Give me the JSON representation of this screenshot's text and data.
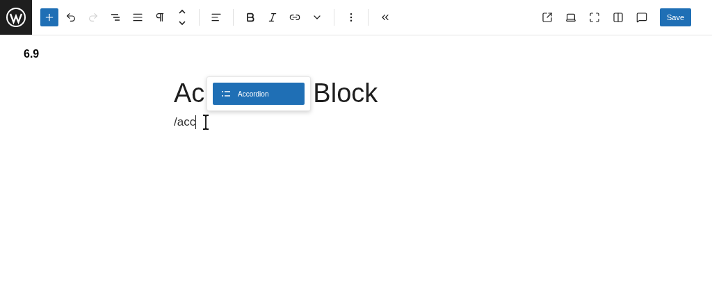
{
  "toolbar": {
    "left": [
      {
        "kind": "inserter",
        "disabled": false
      },
      {
        "kind": "undo",
        "disabled": false
      },
      {
        "kind": "redo",
        "disabled": true
      },
      {
        "kind": "outline",
        "disabled": false
      },
      {
        "kind": "align",
        "disabled": false
      },
      {
        "kind": "paragraph",
        "disabled": false
      },
      {
        "kind": "move",
        "disabled": false
      },
      {
        "kind": "justify",
        "disabled": false
      },
      {
        "kind": "bold",
        "disabled": false
      },
      {
        "kind": "italic",
        "disabled": false
      },
      {
        "kind": "link",
        "disabled": false
      },
      {
        "kind": "more",
        "disabled": false
      },
      {
        "kind": "options",
        "disabled": false
      },
      {
        "kind": "collapse",
        "disabled": false
      }
    ],
    "right": [
      {
        "kind": "external",
        "disabled": false
      },
      {
        "kind": "desktop",
        "disabled": false
      },
      {
        "kind": "fullscreen",
        "disabled": false
      },
      {
        "kind": "sidebar",
        "disabled": false
      },
      {
        "kind": "comment",
        "disabled": false
      }
    ],
    "save_label": "Save"
  },
  "version": "6.9",
  "title_parts": [
    "Ac",
    "Block"
  ],
  "slash_text": "/acc",
  "autocomplete": {
    "items": [
      {
        "label": "Accordion",
        "selected": true
      }
    ]
  }
}
